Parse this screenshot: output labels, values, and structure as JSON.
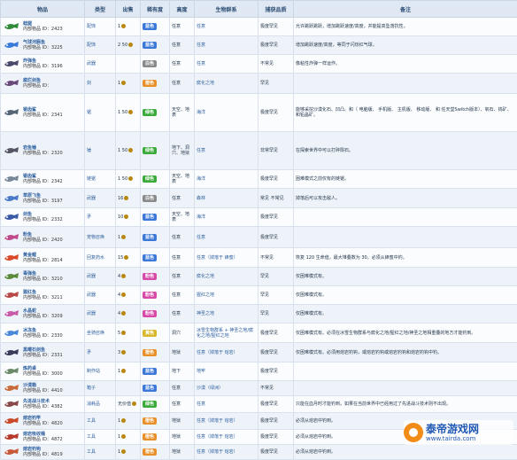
{
  "header": {
    "item": "物品",
    "type": "类型",
    "price": "出售",
    "rarity": "稀有度",
    "height": "高度",
    "biome": "生物群系",
    "catch": "捕获品质",
    "notes": "备注"
  },
  "rows": [
    {
      "name": "蛙腿",
      "tag": "内部物品 ID：2423",
      "type": "配饰",
      "price": "1",
      "rarity": "蓝色",
      "rarity_color": "#3b78d8",
      "height": "任意",
      "biome": "任意",
      "quality": "极度罕见",
      "note": "允许跳跃跳跃，增加跳跃速度/高度，并能提高坠落抗性。",
      "icon": "frog-leg-icon",
      "iconColor": "#2f8a3a"
    },
    {
      "name": "气球河豚鱼",
      "tag": "内部物品 ID：3225",
      "type": "配饰",
      "price": "2 50",
      "rarity": "蓝色",
      "rarity_color": "#3b78d8",
      "height": "任意",
      "biome": "任意",
      "quality": "极度罕见",
      "note": "增加跳跃速度/高度，等同于闪烁红气球。",
      "icon": "balloon-pufferfish-icon",
      "iconColor": "#3a7ad8"
    },
    {
      "name": "炸弹鱼",
      "tag": "内部物品 ID：3196",
      "type": "武器",
      "price": "",
      "rarity": "白色",
      "rarity_color": "#8a8a8a",
      "height": "任意",
      "biome": "任意",
      "quality": "不常见",
      "note": "像粘性炸弹一样运作。",
      "icon": "bomb-fish-icon",
      "iconColor": "#4a4a6a"
    },
    {
      "name": "腐烂剑鱼",
      "tag": "内部物品 ID：",
      "type": "剑",
      "price": "1",
      "rarity": "橙色",
      "rarity_color": "#e8902a",
      "height": "任意",
      "biome": "腐化之地",
      "quality": "罕见",
      "note": "",
      "icon": "sword-fish-icon",
      "iconColor": "#6a4a7a"
    },
    {
      "name": "锯齿鲨",
      "tag": "内部物品 ID：2341",
      "type": "锯",
      "price": "1 50",
      "rarity": "绿色",
      "rarity_color": "#3aaa3a",
      "height": "天空、地表",
      "biome": "海洋",
      "quality": "极度罕见",
      "note": "能够采挖沙漠化石、凹凸、和（ 电脑版、 手机版、 主机版、 移动版、 和 任天堂Switch版本）、氧石、钨矿、和铅晶矿。",
      "icon": "sawtooth-shark-icon",
      "iconColor": "#556677"
    },
    {
      "name": "岩鱼锤",
      "tag": "内部物品 ID：2320",
      "type": "锤",
      "price": "1 50",
      "rarity": "绿色",
      "rarity_color": "#3aaa3a",
      "height": "地下、洞穴、地狱",
      "biome": "任意",
      "quality": "非常罕见",
      "note": "在探索世界中可以打碎陨石。",
      "icon": "rockfish-icon",
      "iconColor": "#555566"
    },
    {
      "name": "锯齿鲨",
      "tag": "内部物品 ID：2342",
      "type": "链锯",
      "price": "1 50",
      "rarity": "绿色",
      "rarity_color": "#3aaa3a",
      "height": "天空、地表",
      "biome": "海洋",
      "quality": "极度罕见",
      "note": "困难模式之前仅有的链锯。",
      "icon": "chainsaw-shark-icon",
      "iconColor": "#778899"
    },
    {
      "name": "草原飞鱼",
      "tag": "内部物品 ID：3197",
      "type": "武器",
      "price": "16",
      "rarity": "白色",
      "rarity_color": "#8a8a8a",
      "height": "任意",
      "biome": "森林",
      "quality": "常见 不常见",
      "note": "掉落后可以攻击敌人。",
      "icon": "flying-fish-icon",
      "iconColor": "#4a7ac8"
    },
    {
      "name": "剑鱼",
      "tag": "内部物品 ID：2332",
      "type": "矛",
      "price": "10",
      "rarity": "蓝色",
      "rarity_color": "#3b78d8",
      "height": "天空、地表",
      "biome": "海洋",
      "quality": "极度罕见",
      "note": "",
      "icon": "swordfish-icon",
      "iconColor": "#3a5aa8"
    },
    {
      "name": "粉鱼",
      "tag": "内部物品 ID：2420",
      "type": "宠物召唤",
      "price": "1",
      "rarity": "蓝色",
      "rarity_color": "#3b78d8",
      "height": "任意",
      "biome": "任意",
      "quality": "极度罕见",
      "note": "",
      "icon": "zephyr-fish-icon",
      "iconColor": "#c04a8a"
    },
    {
      "name": "黄金鲤",
      "tag": "内部物品 ID：2814",
      "type": "回复药水",
      "price": "15",
      "rarity": "蓝色",
      "rarity_color": "#3b78d8",
      "height": "任意",
      "biome": "任意（掉落于 蜂蜜）",
      "quality": "不常见",
      "note": "恢复 120 生命值，最大堆叠数为 30。必须从蜂蜜中钓。",
      "icon": "honeyfin-icon",
      "iconColor": "#d84a2a"
    },
    {
      "name": "毒弹鱼",
      "tag": "内部物品 ID：3210",
      "type": "武器",
      "price": "4",
      "rarity": "粉色",
      "rarity_color": "#d84aa8",
      "height": "任意",
      "biome": "腐化之地",
      "quality": "罕见",
      "note": "仅困难模式有。",
      "icon": "toxikarp-icon",
      "iconColor": "#5a8a3a"
    },
    {
      "name": "猩红鱼",
      "tag": "内部物品 ID：3211",
      "type": "武器",
      "price": "4",
      "rarity": "粉色",
      "rarity_color": "#d84aa8",
      "height": "任意",
      "biome": "猩红之地",
      "quality": "罕见",
      "note": "仅困难模式有。",
      "icon": "crimson-fish-icon",
      "iconColor": "#b84a4a"
    },
    {
      "name": "水晶蛇",
      "tag": "内部物品 ID：3209",
      "type": "武器",
      "price": "4",
      "rarity": "粉色",
      "rarity_color": "#d84aa8",
      "height": "任意",
      "biome": "神圣之地",
      "quality": "罕见",
      "note": "仅困难模式有。",
      "icon": "crystal-serpent-icon",
      "iconColor": "#c85aa8"
    },
    {
      "name": "冰冻鱼",
      "tag": "内部物品 ID：2330",
      "type": "坐骑召唤",
      "price": "5",
      "rarity": "黄色",
      "rarity_color": "#d8b82a",
      "height": "洞穴",
      "biome": "冰雪生物群系 + 神圣之地/腐化之地/猩红之地",
      "quality": "极度罕见",
      "note": "仅困难模式有。必须在冰雪生物群系与腐化之地/猩红之地/神圣之地相重叠的地方才能钓到。",
      "icon": "frost-fish-icon",
      "iconColor": "#4a8ad8"
    },
    {
      "name": "黑曜石剑鱼",
      "tag": "内部物品 ID：2331",
      "type": "矛",
      "price": "3",
      "rarity": "橙色",
      "rarity_color": "#e8902a",
      "height": "地狱",
      "biome": "任意（掉落于 熔岩）",
      "quality": "极度罕见",
      "note": "仅困难模式有。必须用熔岩钓钩，或熔岩钓钩或熔岩钓钩和熔岩钓钩中钓。",
      "icon": "obsidian-swordfish-icon",
      "iconColor": "#3a3a5a"
    },
    {
      "name": "炼药桌",
      "tag": "内部物品 ID：3000",
      "type": "制作站",
      "price": "1",
      "rarity": "蓝色",
      "rarity_color": "#3b78d8",
      "height": "地下",
      "biome": "地牢",
      "quality": "极度罕见",
      "note": "",
      "icon": "alchemy-table-icon",
      "iconColor": "#6a8a6a"
    },
    {
      "name": "沙漠箱",
      "tag": "内部物品 ID：4410",
      "type": "箱子",
      "price": "",
      "rarity": "蓝色",
      "rarity_color": "#3b78d8",
      "height": "任意",
      "biome": "沙漠（绿洲）",
      "quality": "不常见",
      "note": "",
      "icon": "oasis-crate-icon",
      "iconColor": "#c86a3a"
    },
    {
      "name": "先进战斗技术",
      "tag": "内部物品 ID：4382",
      "type": "消耗品",
      "price": "无价值",
      "rarity": "绿色",
      "rarity_color": "#3aaa3a",
      "height": "任意",
      "biome": "任意",
      "quality": "极度罕见",
      "note": "只能在血月时才能钓到。如果在当前世界中已经用过了先进战斗技术则不出现。",
      "icon": "combat-book-icon",
      "iconColor": "#8a4a4a"
    },
    {
      "name": "熔岩钓竿",
      "tag": "内部物品 ID：4820",
      "type": "工具",
      "price": "1",
      "rarity": "橙色",
      "rarity_color": "#e8902a",
      "height": "地狱",
      "biome": "任意（掉落于 熔岩）",
      "quality": "极度罕见",
      "note": "必须从熔岩中钓到。",
      "icon": "lava-rod-icon",
      "iconColor": "#c84a2a"
    },
    {
      "name": "熔岩吸收桶",
      "tag": "内部物品 ID：4872",
      "type": "工具",
      "price": "1",
      "rarity": "橙色",
      "rarity_color": "#e8902a",
      "height": "地狱",
      "biome": "任意（掉落于 熔岩）",
      "quality": "极度罕见",
      "note": "必须从熔岩中钓到。",
      "icon": "lava-bucket-icon",
      "iconColor": "#b83a2a"
    },
    {
      "name": "熔岩钓钩",
      "tag": "内部物品 ID：4819",
      "type": "工具",
      "price": "1",
      "rarity": "橙色",
      "rarity_color": "#e8902a",
      "height": "地狱",
      "biome": "任意（掉落于 熔岩）",
      "quality": "极度罕见",
      "note": "必须从熔岩中钓到。",
      "icon": "lava-hook-icon",
      "iconColor": "#c85a3a"
    }
  ],
  "watermark": {
    "title": "泰帝游戏网",
    "url": "www.tairda.com"
  }
}
